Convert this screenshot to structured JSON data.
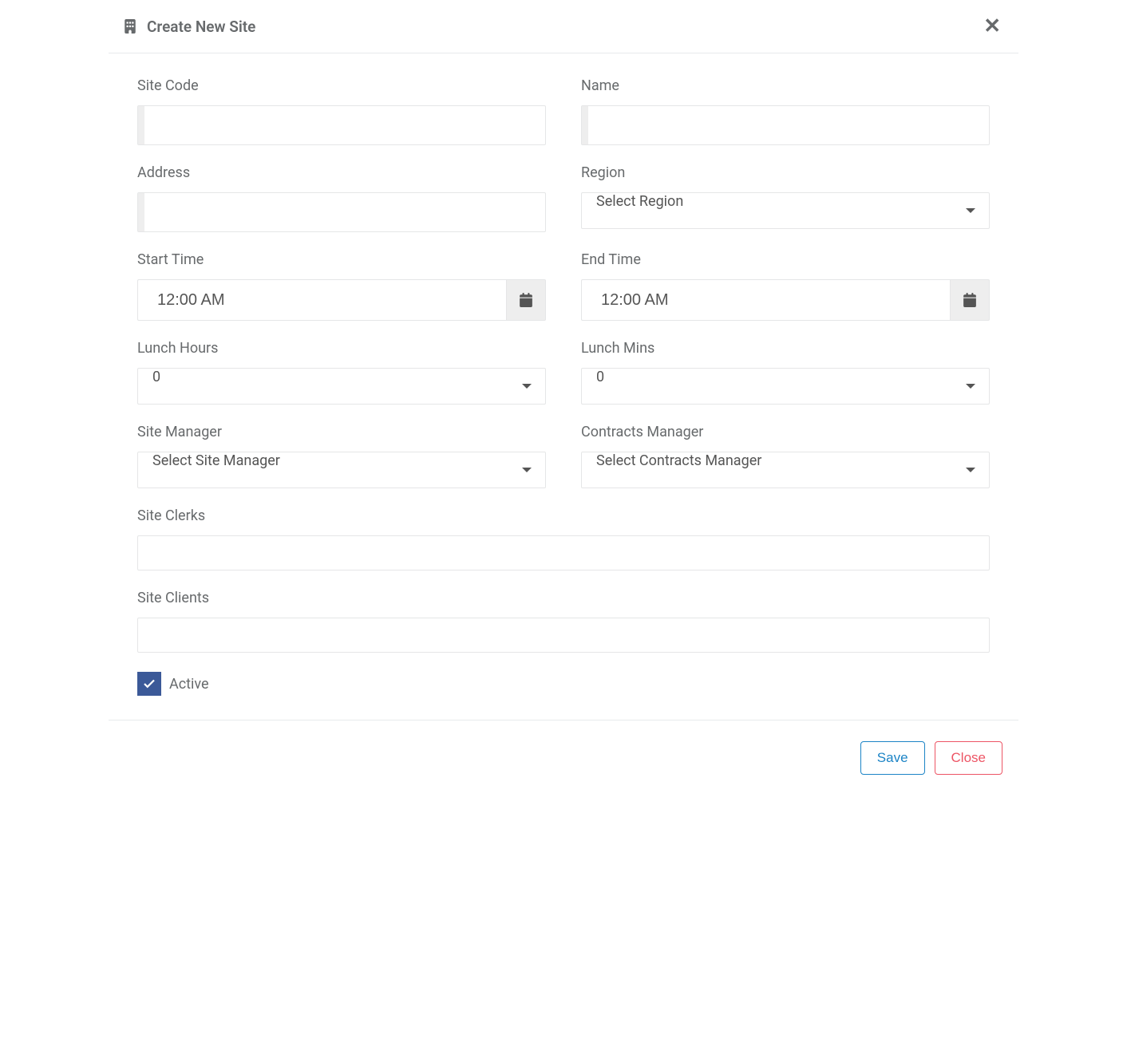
{
  "header": {
    "title": "Create New Site"
  },
  "form": {
    "site_code": {
      "label": "Site Code",
      "value": ""
    },
    "name": {
      "label": "Name",
      "value": ""
    },
    "address": {
      "label": "Address",
      "value": ""
    },
    "region": {
      "label": "Region",
      "selected": "Select Region"
    },
    "start_time": {
      "label": "Start Time",
      "value": "12:00 AM"
    },
    "end_time": {
      "label": "End Time",
      "value": "12:00 AM"
    },
    "lunch_hours": {
      "label": "Lunch Hours",
      "selected": "0"
    },
    "lunch_mins": {
      "label": "Lunch Mins",
      "selected": "0"
    },
    "site_manager": {
      "label": "Site Manager",
      "selected": "Select Site Manager"
    },
    "contracts_manager": {
      "label": "Contracts Manager",
      "selected": "Select Contracts Manager"
    },
    "site_clerks": {
      "label": "Site Clerks",
      "value": ""
    },
    "site_clients": {
      "label": "Site Clients",
      "value": ""
    },
    "active": {
      "label": "Active",
      "checked": true
    }
  },
  "footer": {
    "save": "Save",
    "close": "Close"
  }
}
